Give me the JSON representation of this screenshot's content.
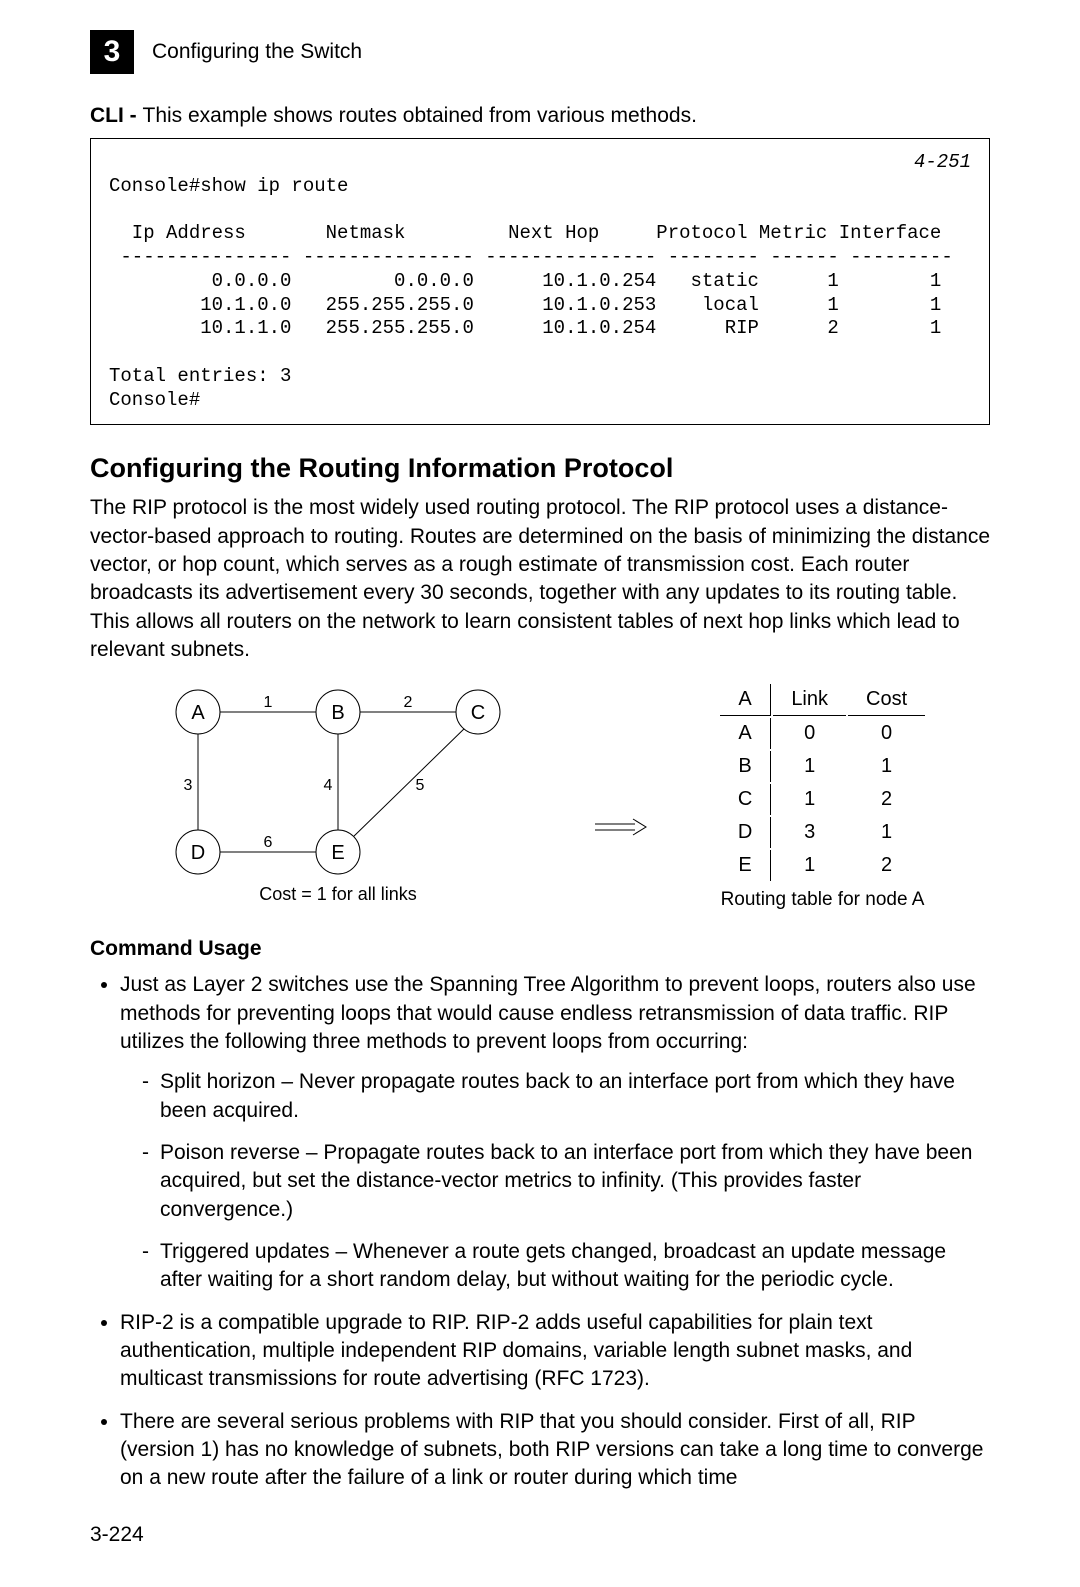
{
  "header": {
    "chapter_number": "3",
    "chapter_title": "Configuring the Switch"
  },
  "cli_intro": {
    "label": "CLI - ",
    "text": "This example shows routes obtained from various methods."
  },
  "terminal": {
    "command": "Console#show ip route",
    "page_ref": "4-251",
    "columns_line": "  Ip Address       Netmask         Next Hop     Protocol Metric Interface",
    "sep_line": " --------------- --------------- --------------- -------- ------ ---------",
    "rows": [
      "         0.0.0.0         0.0.0.0      10.1.0.254   static      1        1",
      "        10.1.0.0   255.255.255.0      10.1.0.253    local      1        1",
      "        10.1.1.0   255.255.255.0      10.1.0.254      RIP      2        1"
    ],
    "footer1": "Total entries: 3",
    "footer2": "Console#"
  },
  "section_title": "Configuring the Routing Information Protocol",
  "section_para": "The RIP protocol is the most widely used routing protocol. The RIP protocol uses a distance-vector-based approach to routing. Routes are determined on the basis of minimizing the distance vector, or hop count, which serves as a rough estimate of transmission cost. Each router broadcasts its advertisement every 30 seconds, together with any updates to its routing table. This allows all routers on the network to learn consistent tables of next hop links which lead to relevant subnets.",
  "diagram": {
    "nodes": {
      "A": "A",
      "B": "B",
      "C": "C",
      "D": "D",
      "E": "E"
    },
    "edge_labels": {
      "1": "1",
      "2": "2",
      "3": "3",
      "4": "4",
      "5": "5",
      "6": "6"
    },
    "caption_left": "Cost = 1 for all links",
    "caption_right": "Routing table for node A"
  },
  "routing_table": {
    "header": [
      "A",
      "Link",
      "Cost"
    ],
    "rows": [
      [
        "A",
        "0",
        "0"
      ],
      [
        "B",
        "1",
        "1"
      ],
      [
        "C",
        "1",
        "2"
      ],
      [
        "D",
        "3",
        "1"
      ],
      [
        "E",
        "1",
        "2"
      ]
    ]
  },
  "command_usage_label": "Command Usage",
  "bullets": [
    {
      "text": "Just as Layer 2 switches use the Spanning Tree Algorithm to prevent loops, routers also use methods for preventing loops that would cause endless retransmission of data traffic. RIP utilizes the following three methods to prevent loops from occurring:",
      "sub": [
        "Split horizon – Never propagate routes back to an interface port from which they have been acquired.",
        "Poison reverse – Propagate routes back to an interface port from which they have been acquired, but set the distance-vector metrics to infinity. (This provides faster convergence.)",
        "Triggered updates – Whenever a route gets changed, broadcast an update message after waiting for a short random delay, but without waiting for the periodic cycle."
      ]
    },
    {
      "text": "RIP-2 is a compatible upgrade to RIP. RIP-2 adds useful capabilities for plain text authentication, multiple independent RIP domains, variable length subnet masks, and multicast transmissions for route advertising (RFC 1723)."
    },
    {
      "text": "There are several serious problems with RIP that you should consider. First of all, RIP (version 1) has no knowledge of subnets, both RIP versions can take a long time to converge on a new route after the failure of a link or router during which time"
    }
  ],
  "page_number": "3-224"
}
